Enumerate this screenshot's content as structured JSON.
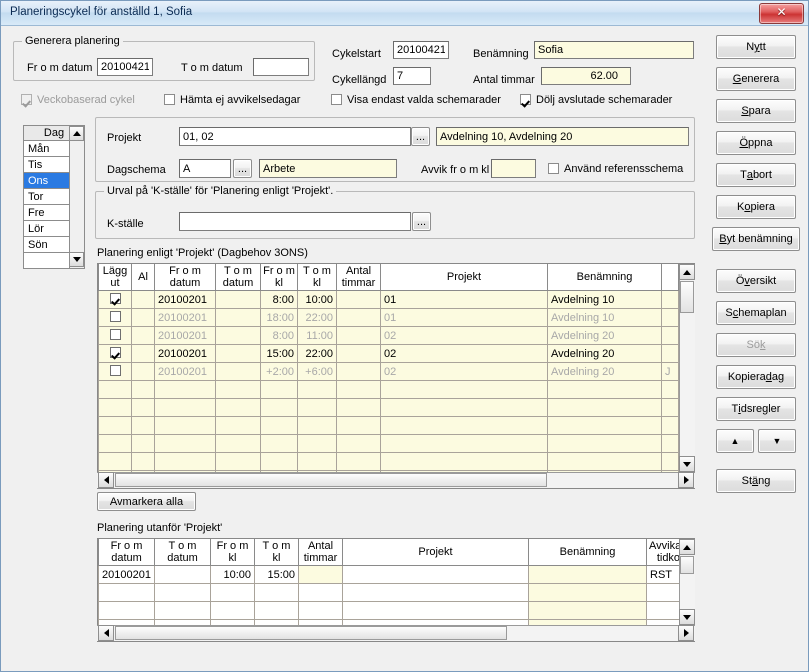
{
  "window": {
    "title": "Planeringscykel för anställd 1, Sofia",
    "close_label": "✕"
  },
  "generate_group": {
    "caption": "Generera planering",
    "from_label": "Fr o m datum",
    "from_value": "20100421",
    "to_label": "T o m datum",
    "to_value": ""
  },
  "cycle": {
    "start_label": "Cykelstart",
    "start_value": "20100421",
    "length_label": "Cykellängd",
    "length_value": "7",
    "name_label": "Benämning",
    "name_value": "Sofia",
    "hours_label": "Antal timmar",
    "hours_value": "62.00"
  },
  "options": [
    {
      "label": "Veckobaserad cykel",
      "checked": true,
      "disabled": true
    },
    {
      "label": "Hämta ej avvikelsedagar",
      "checked": false,
      "disabled": false
    },
    {
      "label": "Visa endast valda schemarader",
      "checked": false,
      "disabled": false
    },
    {
      "label": "Dölj avslutade schemarader",
      "checked": true,
      "disabled": false
    }
  ],
  "daylist": {
    "header": "Dag",
    "items": [
      "Mån",
      "Tis",
      "Ons",
      "Tor",
      "Fre",
      "Lör",
      "Sön"
    ],
    "selected": "Ons"
  },
  "project_panel": {
    "projekt_label": "Projekt",
    "projekt_value": "01, 02",
    "projekt_browse": "...",
    "projekt_desc": "Avdelning 10, Avdelning 20",
    "dagschema_label": "Dagschema",
    "dagschema_value": "A",
    "dagschema_browse": "...",
    "dagschema_desc": "Arbete",
    "avvik_label": "Avvik fr o m kl",
    "avvik_value": "",
    "ref_checkbox": "Använd referensschema",
    "ref_checked": false
  },
  "kstalle_group": {
    "caption": "Urval på 'K-ställe' för 'Planering enligt 'Projekt'.",
    "label": "K-ställe",
    "value": "",
    "browse": "..."
  },
  "main_grid": {
    "title": "Planering enligt 'Projekt'  (Dagbehov 3ONS)",
    "columns": [
      {
        "l1": "Lägg",
        "l2": "ut"
      },
      {
        "l1": "Al",
        "l2": ""
      },
      {
        "l1": "Fr o m",
        "l2": "datum"
      },
      {
        "l1": "T o m",
        "l2": "datum"
      },
      {
        "l1": "Fr o m",
        "l2": "kl"
      },
      {
        "l1": "T o m",
        "l2": "kl"
      },
      {
        "l1": "Antal",
        "l2": "timmar"
      },
      {
        "l1": "Projekt",
        "l2": ""
      },
      {
        "l1": "Benämning",
        "l2": ""
      },
      {
        "l1": "",
        "l2": ""
      }
    ],
    "rows": [
      {
        "checked": true,
        "dim": false,
        "al": "",
        "from_date": "20100201",
        "to_date": "",
        "from_kl": "8:00",
        "to_kl": "10:00",
        "hours": "",
        "projekt": "01",
        "benamning": "Avdelning 10",
        "extra": ""
      },
      {
        "checked": false,
        "dim": true,
        "al": "",
        "from_date": "20100201",
        "to_date": "",
        "from_kl": "18:00",
        "to_kl": "22:00",
        "hours": "",
        "projekt": "01",
        "benamning": "Avdelning 10",
        "extra": ""
      },
      {
        "checked": false,
        "dim": true,
        "al": "",
        "from_date": "20100201",
        "to_date": "",
        "from_kl": "8:00",
        "to_kl": "11:00",
        "hours": "",
        "projekt": "02",
        "benamning": "Avdelning 20",
        "extra": ""
      },
      {
        "checked": true,
        "dim": false,
        "al": "",
        "from_date": "20100201",
        "to_date": "",
        "from_kl": "15:00",
        "to_kl": "22:00",
        "hours": "",
        "projekt": "02",
        "benamning": "Avdelning 20",
        "extra": ""
      },
      {
        "checked": false,
        "dim": true,
        "al": "",
        "from_date": "20100201",
        "to_date": "",
        "from_kl": "+2:00",
        "to_kl": "+6:00",
        "hours": "",
        "projekt": "02",
        "benamning": "Avdelning 20",
        "extra": "J"
      }
    ],
    "empty_rows": 7
  },
  "deselect_button": "Avmarkera alla",
  "outside_grid": {
    "title": "Planering utanför 'Projekt'",
    "columns": [
      {
        "l1": "Fr o m",
        "l2": "datum"
      },
      {
        "l1": "T o m",
        "l2": "datum"
      },
      {
        "l1": "Fr o m",
        "l2": "kl"
      },
      {
        "l1": "T o m",
        "l2": "kl"
      },
      {
        "l1": "Antal",
        "l2": "timmar"
      },
      {
        "l1": "Projekt",
        "l2": ""
      },
      {
        "l1": "Benämning",
        "l2": ""
      },
      {
        "l1": "Avvikande",
        "l2": "tidkod"
      }
    ],
    "rows": [
      {
        "from_date": "20100201",
        "to_date": "",
        "from_kl": "10:00",
        "to_kl": "15:00",
        "hours": "",
        "projekt": "",
        "benamning": "",
        "tidkod": "RST"
      }
    ],
    "empty_rows": 3
  },
  "side_buttons": [
    {
      "pre": "N",
      "acc": "y",
      "post": "tt",
      "disabled": false,
      "name": "nytt"
    },
    {
      "pre": "",
      "acc": "G",
      "post": "enerera",
      "disabled": false,
      "name": "generera"
    },
    {
      "pre": "",
      "acc": "S",
      "post": "para",
      "disabled": false,
      "name": "spara"
    },
    {
      "pre": "",
      "acc": "Ö",
      "post": "ppna",
      "disabled": false,
      "name": "oppna"
    },
    {
      "pre": "T",
      "acc": "a",
      "post": " bort",
      "disabled": false,
      "name": "ta-bort"
    },
    {
      "pre": "K",
      "acc": "o",
      "post": "piera",
      "disabled": false,
      "name": "kopiera"
    },
    {
      "pre": "",
      "acc": "B",
      "post": "yt benämning",
      "disabled": false,
      "name": "byt-benamning"
    },
    {
      "pre": "Ö",
      "acc": "v",
      "post": "ersikt",
      "disabled": false,
      "name": "oversikt"
    },
    {
      "pre": "S",
      "acc": "c",
      "post": "hemaplan",
      "disabled": false,
      "name": "schemaplan"
    },
    {
      "pre": "Sö",
      "acc": "k",
      "post": "",
      "disabled": true,
      "name": "sok"
    },
    {
      "pre": "Kopiera ",
      "acc": "d",
      "post": "ag",
      "disabled": false,
      "name": "kopiera-dag"
    },
    {
      "pre": "T",
      "acc": "i",
      "post": "dsregler",
      "disabled": false,
      "name": "tidsregler"
    }
  ],
  "nav_buttons": {
    "up": "▲",
    "down": "▼"
  },
  "close_button": {
    "pre": "St",
    "acc": "ä",
    "post": "ng"
  }
}
